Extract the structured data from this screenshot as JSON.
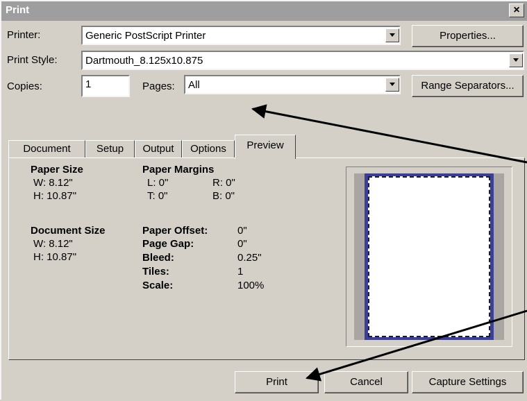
{
  "window": {
    "title": "Print",
    "close_symbol": "×"
  },
  "printer": {
    "label": "Printer:",
    "value": "Generic PostScript Printer",
    "properties_button": "Properties..."
  },
  "print_style": {
    "label": "Print Style:",
    "value": "Dartmouth_8.125x10.875"
  },
  "copies": {
    "label": "Copies:",
    "value": "1"
  },
  "pages": {
    "label": "Pages:",
    "value": "All",
    "range_button": "Range Separators..."
  },
  "tabs": [
    {
      "label": "Document"
    },
    {
      "label": "Setup"
    },
    {
      "label": "Output"
    },
    {
      "label": "Options"
    },
    {
      "label": "Preview",
      "active": true
    }
  ],
  "preview": {
    "paper_size": {
      "heading": "Paper Size",
      "w": "W: 8.12\"",
      "h": "H: 10.87\""
    },
    "paper_margins": {
      "heading": "Paper Margins",
      "l": "L: 0\"",
      "r": "R: 0\"",
      "t": "T: 0\"",
      "b": "B: 0\""
    },
    "document_size": {
      "heading": "Document Size",
      "w": "W: 8.12\"",
      "h": "H: 10.87\""
    },
    "settings": [
      {
        "label": "Paper Offset:",
        "value": "0\""
      },
      {
        "label": "Page Gap:",
        "value": "0\""
      },
      {
        "label": "Bleed:",
        "value": "0.25\""
      },
      {
        "label": "Tiles:",
        "value": "1"
      },
      {
        "label": "Scale:",
        "value": "100%"
      }
    ]
  },
  "buttons": {
    "print": "Print",
    "cancel": "Cancel",
    "capture": "Capture Settings"
  }
}
